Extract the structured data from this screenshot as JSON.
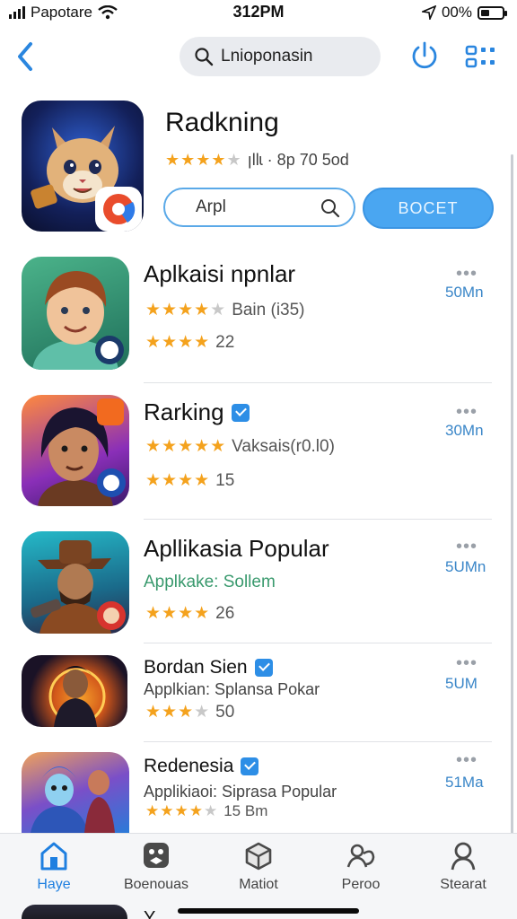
{
  "status_bar": {
    "carrier": "Papotare",
    "time": "312PM",
    "battery": "00%"
  },
  "search": {
    "placeholder": "Lnioponasin"
  },
  "featured": {
    "title": "Radkning",
    "rating_text": "ꞁllɩ · 8p 70 5od",
    "input_value": "Arpl",
    "button_label": "BOCET"
  },
  "apps": [
    {
      "title": "Aplkaisi npnlar",
      "subtitle": "Bain (i35)",
      "rating_count": "22",
      "size": "50Mn"
    },
    {
      "title": "Rarking",
      "subtitle": "Vaksais(r0.l0)",
      "rating_count": "15",
      "size": "30Mn"
    },
    {
      "title": "Apllikasia Popular",
      "subtitle": "Applkake: Sollem",
      "rating_count": "26",
      "size": "5UMn"
    },
    {
      "title": "Bordan Sien",
      "subtitle": "Applkian: Splansa Pokar",
      "rating_count": "50",
      "size": "5UM"
    },
    {
      "title": "Redenesia",
      "subtitle": "Applikiaoi: Siprasa Popular",
      "rating_count": "15 Bm",
      "size": "51Ma"
    }
  ],
  "peek": {
    "title": "Y"
  },
  "tabs": [
    {
      "label": "Haye",
      "icon": "home-icon",
      "active": true
    },
    {
      "label": "Boenouas",
      "icon": "games-icon",
      "active": false
    },
    {
      "label": "Matiot",
      "icon": "box-icon",
      "active": false
    },
    {
      "label": "Peroo",
      "icon": "people-icon",
      "active": false
    },
    {
      "label": "Stearat",
      "icon": "person-icon",
      "active": false
    }
  ],
  "colors": {
    "accent": "#1e7fe0",
    "star": "#f4a21d",
    "button": "#4aa6f1",
    "size_text": "#3a86c8"
  }
}
